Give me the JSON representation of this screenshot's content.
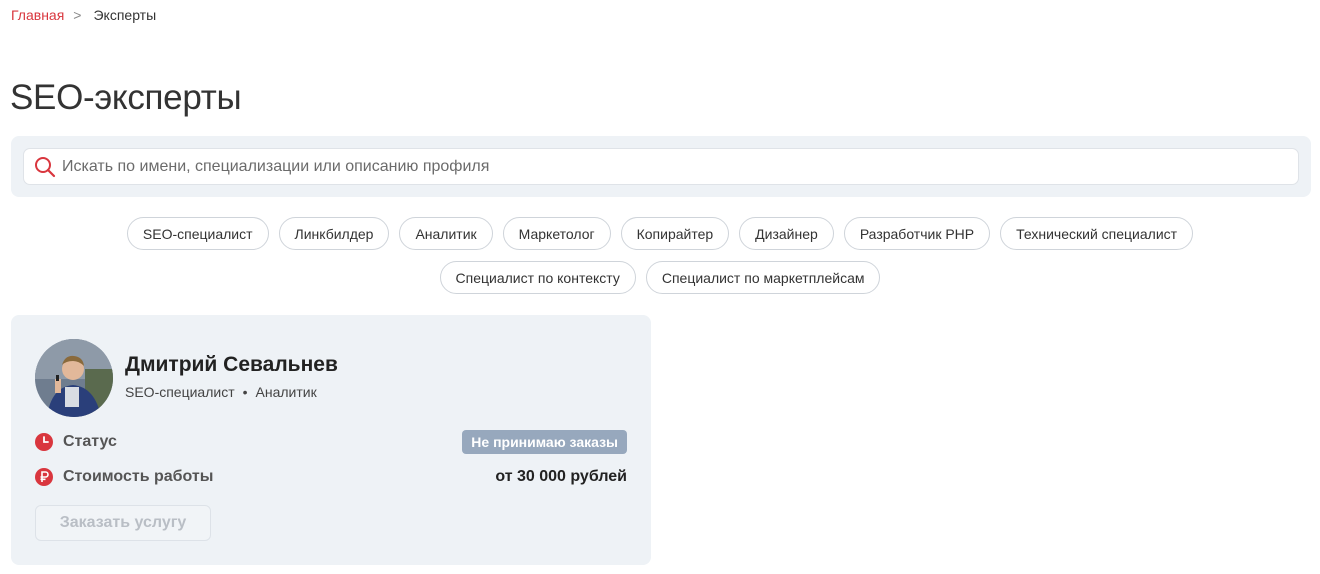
{
  "breadcrumb": {
    "home": "Главная",
    "separator": ">",
    "current": "Эксперты"
  },
  "page": {
    "title": "SEO-эксперты"
  },
  "search": {
    "placeholder": "Искать по имени, специализации или описанию профиля",
    "value": "",
    "icon": "search-icon"
  },
  "filters": [
    "SEO-специалист",
    "Линкбилдер",
    "Аналитик",
    "Маркетолог",
    "Копирайтер",
    "Дизайнер",
    "Разработчик PHP",
    "Технический специалист",
    "Специалист по контексту",
    "Специалист по маркетплейсам"
  ],
  "expert": {
    "name": "Дмитрий Севальнев",
    "roles": [
      "SEO-специалист",
      "Аналитик"
    ],
    "role_separator": "•",
    "status_label": "Статус",
    "status_icon": "clock-icon",
    "status_value": "Не принимаю заказы",
    "price_label": "Стоимость работы",
    "price_icon": "ruble-icon",
    "price_value": "от 30 000 рублей",
    "order_button": "Заказать услугу"
  },
  "colors": {
    "accent": "#d9363e",
    "badge": "#97a8bd",
    "panel": "#eef2f6"
  }
}
